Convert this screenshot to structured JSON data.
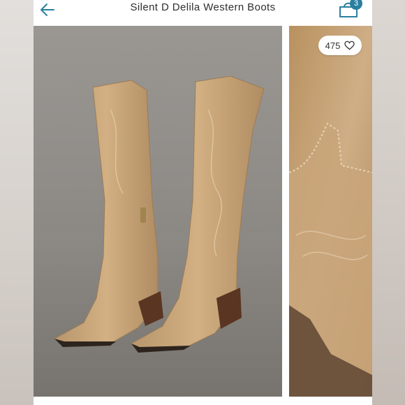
{
  "header": {
    "title": "Silent D Delila Western Boots",
    "back_icon": "arrow-left-icon",
    "bag_icon": "shopping-bag-icon",
    "bag_count": "3"
  },
  "gallery": {
    "main_image": "boots-main-photo",
    "detail_image": "boots-detail-photo",
    "likes": "475",
    "like_icon": "heart-icon"
  },
  "colors": {
    "accent": "#2a7fa0",
    "suede": "#c9a57a",
    "background": "#908d89"
  }
}
